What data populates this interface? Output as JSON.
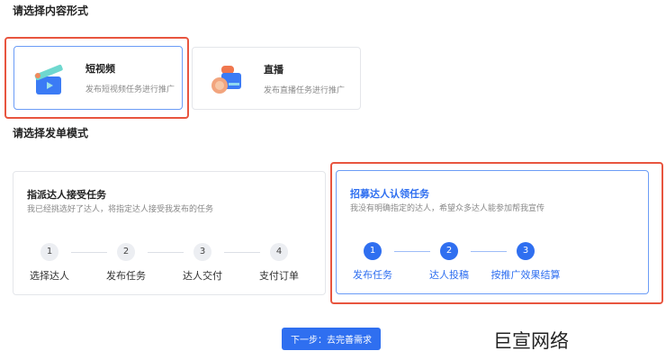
{
  "section1": {
    "title": "请选择内容形式",
    "options": [
      {
        "title": "短视频",
        "desc": "发布短视频任务进行推广",
        "icon": "clapperboard-icon"
      },
      {
        "title": "直播",
        "desc": "发布直播任务进行推广",
        "icon": "video-camera-icon"
      }
    ]
  },
  "section2": {
    "title": "请选择发单模式",
    "modes": [
      {
        "title": "指派达人接受任务",
        "desc": "我已经挑选好了达人，将指定达人接受我发布的任务",
        "steps": [
          {
            "n": "1",
            "label": "选择达人"
          },
          {
            "n": "2",
            "label": "发布任务"
          },
          {
            "n": "3",
            "label": "达人交付"
          },
          {
            "n": "4",
            "label": "支付订单"
          }
        ]
      },
      {
        "title": "招募达人认领任务",
        "desc": "我没有明确指定的达人，希望众多达人能参加帮我宣传",
        "steps": [
          {
            "n": "1",
            "label": "发布任务"
          },
          {
            "n": "2",
            "label": "达人投稿"
          },
          {
            "n": "3",
            "label": "按推广效果结算"
          }
        ]
      }
    ]
  },
  "next_button": "下一步：去完善需求",
  "watermark": "巨宣网络",
  "colors": {
    "accent": "#2f6ff0",
    "highlight": "#e8553f"
  }
}
